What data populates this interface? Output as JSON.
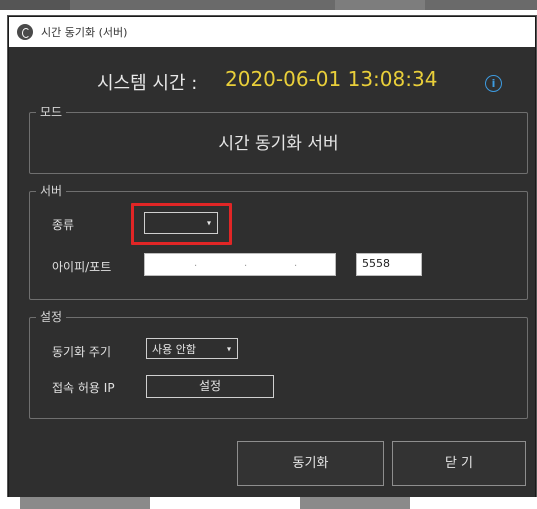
{
  "window": {
    "title": "시간 동기화 (서버)"
  },
  "system_time": {
    "label": "시스템 시간 :",
    "value": "2020-06-01 13:08:34",
    "value_color": "#e9cf3a",
    "info_icon_glyph": "i"
  },
  "mode_group": {
    "legend": "모드",
    "mode_text": "시간 동기화 서버"
  },
  "server_group": {
    "legend": "서버",
    "type_label": "종류",
    "type_value": "",
    "ip_port_label": "아이피/포트",
    "ip_dots": [
      ".",
      ".",
      "."
    ],
    "port_value": "5558",
    "highlight_color": "#e12626"
  },
  "settings_group": {
    "legend": "설정",
    "sync_period_label": "동기화 주기",
    "sync_period_value": "사용 안함",
    "allowed_ip_label": "접속 허용 IP",
    "settings_button": "설정"
  },
  "footer": {
    "sync_button": "동기화",
    "close_button": "닫 기"
  },
  "icons": {
    "app": "app-clock-icon",
    "info": "info-icon",
    "dropdown": "chevron-down-icon"
  }
}
